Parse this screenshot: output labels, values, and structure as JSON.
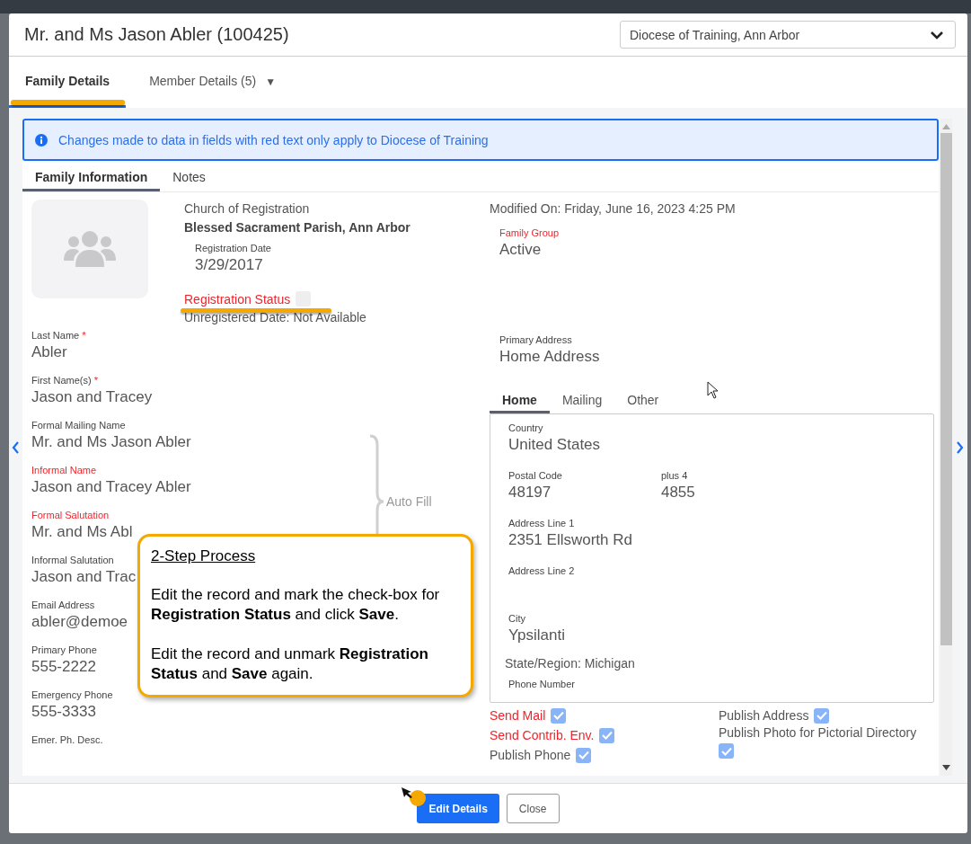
{
  "page_title": "Mr. and Ms Jason Abler (100425)",
  "org_select": {
    "value": "Diocese of Training, Ann Arbor"
  },
  "tabs": [
    {
      "label": "Family Details",
      "selected": true,
      "highlighted": true
    },
    {
      "label": "Member Details (5)",
      "selected": false,
      "highlighted": false,
      "caret": "▼"
    }
  ],
  "notice": "Changes made to data in fields with red text only apply to Diocese of Training",
  "subtabs": [
    {
      "label": "Family Information",
      "selected": true
    },
    {
      "label": "Notes",
      "selected": false
    }
  ],
  "church": {
    "label": "Church of Registration",
    "value": "Blessed Sacrament Parish, Ann Arbor"
  },
  "registration_date": {
    "label": "Registration Date",
    "value": "3/29/2017"
  },
  "registration_status": {
    "label": "Registration Status",
    "checked": false,
    "restricted": true,
    "highlighted": true
  },
  "unregistered": "Unregistered Date: Not Available",
  "modified": "Modified On: Friday, June 16, 2023 4:25 PM",
  "family_group": {
    "label": "Family Group",
    "value": "Active",
    "restricted": true
  },
  "fields": [
    {
      "label": "Last Name",
      "marker": "*",
      "value": "Abler",
      "restricted": false
    },
    {
      "label": "First Name(s)",
      "marker": "*",
      "value": "Jason and Tracey",
      "restricted": false
    },
    {
      "label": "Formal Mailing Name",
      "value": "Mr. and Ms Jason Abler",
      "restricted": false
    },
    {
      "label": "Informal Name",
      "value": "Jason and Tracey Abler",
      "restricted": true
    },
    {
      "label": "Formal Salutation",
      "value": "Mr. and Ms Abl",
      "restricted": true
    },
    {
      "label": "Informal Salutation",
      "value": "Jason and Trac",
      "restricted": false
    },
    {
      "label": "Email Address",
      "value": "abler@demoe",
      "restricted": false
    },
    {
      "label": "Primary Phone",
      "value": "555-2222",
      "restricted": false
    },
    {
      "label": "Emergency Phone",
      "value": "555-3333",
      "restricted": false
    },
    {
      "label": "Emer. Ph. Desc.",
      "restricted": false
    }
  ],
  "auto_fill": "Auto Fill",
  "primary_address": {
    "label": "Primary Address",
    "value": "Home Address"
  },
  "address_tabs": [
    {
      "label": "Home",
      "selected": true
    },
    {
      "label": "Mailing",
      "selected": false
    },
    {
      "label": "Other",
      "selected": false
    }
  ],
  "address_rows": [
    {
      "kind": "fields",
      "cells": [
        {
          "label": "Country",
          "value": "United States"
        }
      ]
    },
    {
      "kind": "fields",
      "cells": [
        {
          "label": "Postal Code",
          "value": "48197"
        },
        {
          "label": "plus 4",
          "value": "4855"
        }
      ]
    },
    {
      "kind": "fields",
      "cells": [
        {
          "label": "Address Line 1",
          "value": "2351 Ellsworth Rd"
        }
      ]
    },
    {
      "kind": "fields",
      "cells": [
        {
          "label": "Address Line 2"
        }
      ]
    },
    {
      "kind": "fields",
      "cells": [
        {
          "label": "City",
          "value": "Ypsilanti"
        }
      ]
    },
    {
      "kind": "text",
      "text": "State/Region: Michigan"
    },
    {
      "kind": "fields",
      "cells": [
        {
          "label": "Phone Number"
        }
      ]
    }
  ],
  "flags": [
    {
      "label": "Send Mail",
      "checked": true,
      "restricted": true
    },
    {
      "label": "Publish Address",
      "checked": true,
      "restricted": false
    },
    {
      "label": "Send Contrib. Env.",
      "checked": true,
      "restricted": true
    },
    {
      "label": "Publish Photo for Pictorial Directory",
      "checked": true,
      "restricted": false
    },
    {
      "label": "Publish Phone",
      "checked": true,
      "restricted": false
    }
  ],
  "callout": {
    "title": "2-Step Process",
    "paragraphs": [
      "Edit the record and mark the check-box for **Registration Status** and click **Save**.",
      "Edit the record and unmark **Registration Status** and **Save** again."
    ]
  },
  "buttons": [
    {
      "label": "Edit Details",
      "kind": "primary",
      "highlighted": true
    },
    {
      "label": "Close",
      "kind": "secondary",
      "highlighted": false
    }
  ]
}
